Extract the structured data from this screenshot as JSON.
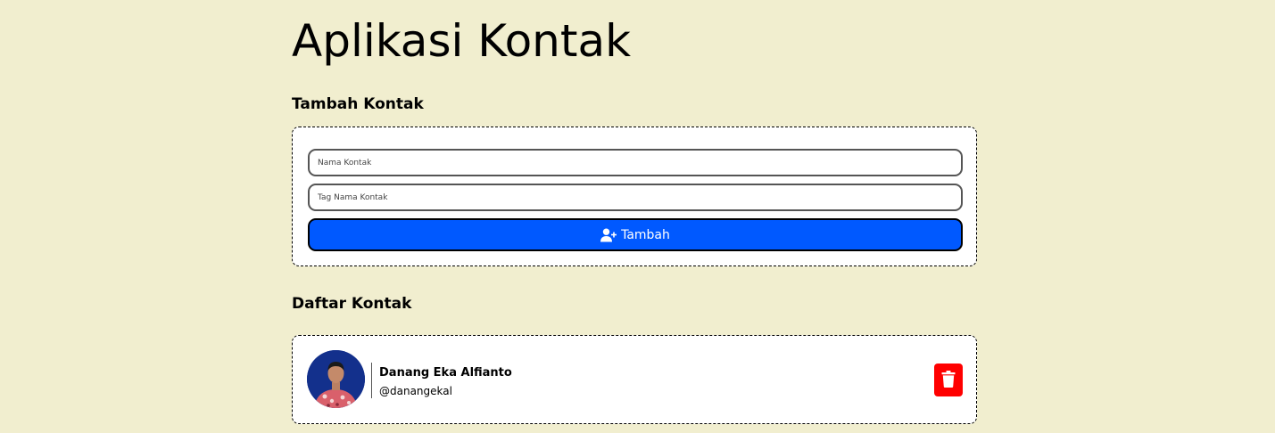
{
  "app": {
    "title": "Aplikasi Kontak"
  },
  "add_section": {
    "title": "Tambah Kontak",
    "name_placeholder": "Nama Kontak",
    "tag_placeholder": "Tag Nama Kontak",
    "name_value": "",
    "tag_value": "",
    "add_button_label": "Tambah",
    "add_button_icon": "user-plus-icon"
  },
  "list_section": {
    "title": "Daftar Kontak",
    "contacts": [
      {
        "name": "Danang Eka Alfianto",
        "tag": "@danangekal",
        "delete_icon": "trash-icon"
      }
    ]
  },
  "colors": {
    "background": "#f1eecf",
    "primary_button": "#0059ff",
    "delete_button": "#ff0000"
  }
}
